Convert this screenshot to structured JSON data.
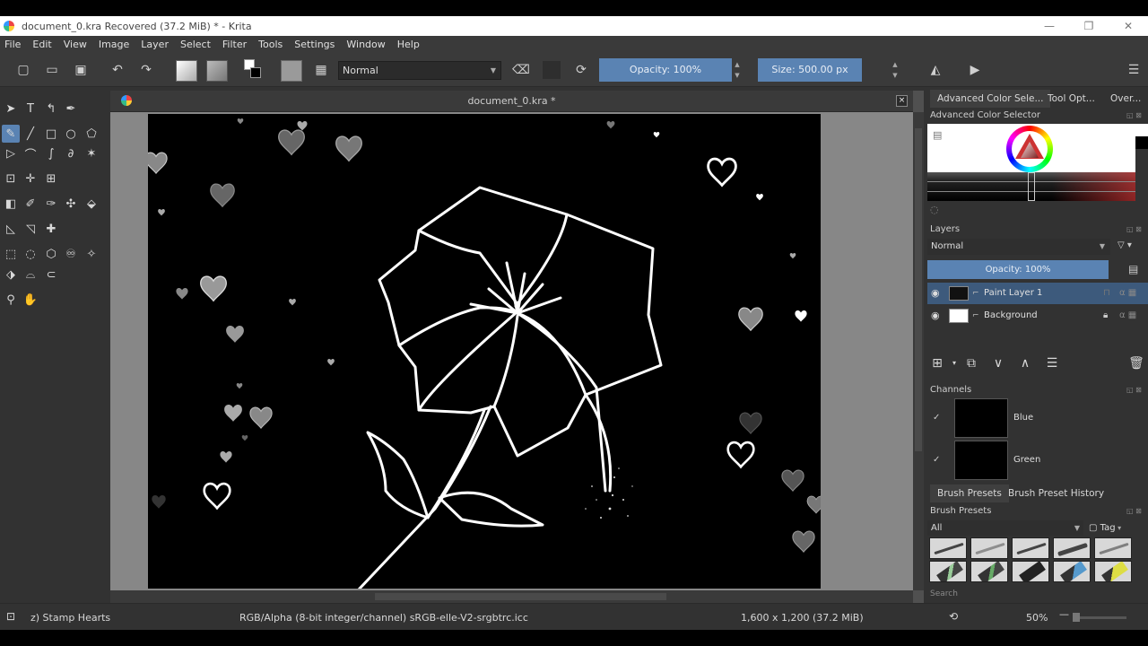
{
  "window": {
    "title": "document_0.kra Recovered  (37.2 MiB)  * - Krita",
    "minimize": "—",
    "restore": "❐",
    "close": "✕"
  },
  "menu": [
    "File",
    "Edit",
    "View",
    "Image",
    "Layer",
    "Select",
    "Filter",
    "Tools",
    "Settings",
    "Window",
    "Help"
  ],
  "toolbar": {
    "blend_mode": "Normal",
    "opacity_label": "Opacity: 100%",
    "size_label": "Size: 500.00 px",
    "icons": [
      "new-document-icon",
      "open-icon",
      "save-icon",
      "undo-icon",
      "redo-icon",
      "gradient-fg-icon",
      "pattern-icon",
      "fg-bg-color-icon",
      "brush-preset-icon",
      "workspace-grid-icon",
      "eraser-icon",
      "preserve-alpha-icon",
      "reload-icon",
      "mirror-horizontal-icon",
      "mirror-vertical-icon",
      "workspace-icon"
    ]
  },
  "document_tab": {
    "title": "document_0.kra *",
    "close": "×"
  },
  "dockers": {
    "top_tabs": [
      "Advanced Color Sele...",
      "Tool Opt...",
      "Over..."
    ],
    "color_selector_title": "Advanced Color Selector",
    "layers": {
      "title": "Layers",
      "blend_mode": "Normal",
      "opacity": "Opacity:  100%",
      "items": [
        {
          "name": "Paint Layer 1",
          "selected": true
        },
        {
          "name": "Background",
          "selected": false
        }
      ]
    },
    "channels": {
      "title": "Channels",
      "items": [
        {
          "name": "Blue",
          "check": "✓"
        },
        {
          "name": "Green",
          "check": "✓"
        }
      ]
    },
    "brush_tabs": [
      "Brush Presets",
      "Brush Preset History"
    ],
    "brush_presets": {
      "title": "Brush Presets",
      "filter": "All",
      "tag": "Tag",
      "search": "Search"
    }
  },
  "status": {
    "brush": "z) Stamp Hearts",
    "colorspace": "RGB/Alpha (8-bit integer/channel)  sRGB-elle-V2-srgbtrc.icc",
    "size": "1,600 x 1,200 (37.2 MiB)",
    "zoom": "50%"
  },
  "colors": {
    "accent": "#5a83b3",
    "panel": "#323232",
    "canvas_bg": "#000000"
  }
}
